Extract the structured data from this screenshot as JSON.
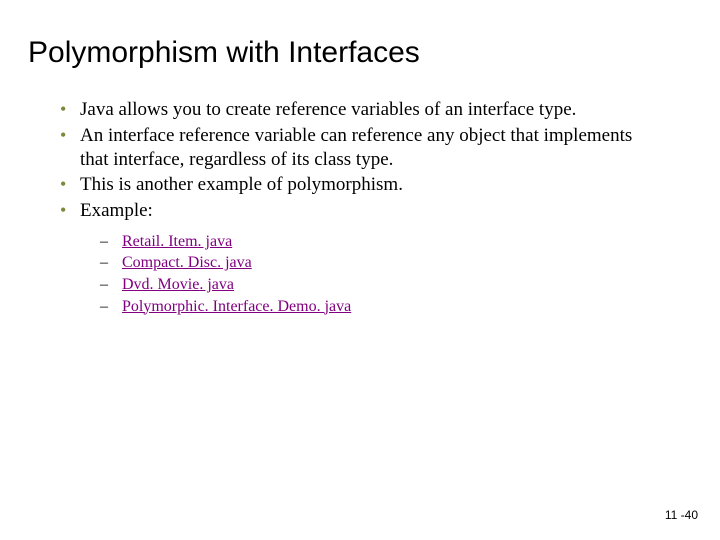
{
  "title": "Polymorphism with Interfaces",
  "bullets": [
    "Java allows you to create reference variables of an interface type.",
    "An interface reference variable can reference any object that implements that interface, regardless of its class type.",
    "This is another example of polymorphism.",
    "Example:"
  ],
  "links": [
    "Retail. Item. java",
    "Compact. Disc. java",
    "Dvd. Movie. java",
    "Polymorphic. Interface. Demo. java"
  ],
  "page_number": "11 -40"
}
